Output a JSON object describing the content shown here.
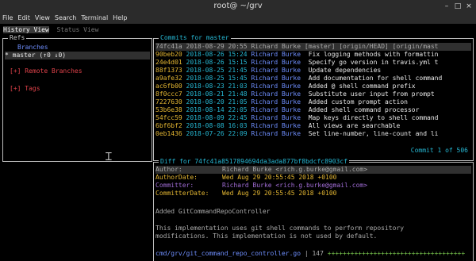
{
  "window": {
    "title": "root@           ~/grv",
    "controls": [
      "–",
      "□",
      "×"
    ]
  },
  "menu": [
    "File",
    "Edit",
    "View",
    "Search",
    "Terminal",
    "Help"
  ],
  "tabs": {
    "active": "History View",
    "inactive": "Status View"
  },
  "refs": {
    "title": "Refs",
    "branches_header": "Branches",
    "branch_marker": "*",
    "current_branch": "master (↑0 ↓0)",
    "remote_branches": "[+] Remote Branches",
    "tags": "[+] Tags"
  },
  "commits": {
    "title": "Commits for master",
    "footer": "Commit 1 of 506",
    "rows": [
      {
        "hash": "74fc41a",
        "date": "2018-08-29 20:55",
        "author": "Richard Burke",
        "refs": "[master] [origin/HEAD] [origin/mast",
        "message": ""
      },
      {
        "hash": "90beb20",
        "date": "2018-08-26 15:24",
        "author": "Richard Burke",
        "refs": "",
        "message": "Fix logging methods with formattin"
      },
      {
        "hash": "24e4d01",
        "date": "2018-08-26 15:15",
        "author": "Richard Burke",
        "refs": "",
        "message": "Specify go version in travis.yml t"
      },
      {
        "hash": "88f1373",
        "date": "2018-08-25 21:45",
        "author": "Richard Burke",
        "refs": "",
        "message": "Update dependencies"
      },
      {
        "hash": "a9afe32",
        "date": "2018-08-25 15:45",
        "author": "Richard Burke",
        "refs": "",
        "message": "Add documentation for shell command"
      },
      {
        "hash": "ac6fb00",
        "date": "2018-08-23 21:03",
        "author": "Richard Burke",
        "refs": "",
        "message": "Added @ shell command prefix"
      },
      {
        "hash": "8f0ccc7",
        "date": "2018-08-21 21:48",
        "author": "Richard Burke",
        "refs": "",
        "message": "Substitute user input from prompt"
      },
      {
        "hash": "7227630",
        "date": "2018-08-20 21:05",
        "author": "Richard Burke",
        "refs": "",
        "message": "Added custom prompt action"
      },
      {
        "hash": "53b6e38",
        "date": "2018-08-14 22:05",
        "author": "Richard Burke",
        "refs": "",
        "message": "Added shell command processor"
      },
      {
        "hash": "54fcc59",
        "date": "2018-08-09 22:45",
        "author": "Richard Burke",
        "refs": "",
        "message": "Map keys directly to shell command"
      },
      {
        "hash": "6bf6bf2",
        "date": "2018-08-08 16:03",
        "author": "Richard Burke",
        "refs": "",
        "message": "All views are searchable"
      },
      {
        "hash": "0eb1436",
        "date": "2018-07-26 22:09",
        "author": "Richard Burke",
        "refs": "",
        "message": "Set line-number, line-count and li"
      }
    ]
  },
  "diff": {
    "title": "Diff for 74fc41a8517894694da3ada877bf8bdcfc8903cf",
    "author_label": "Author:",
    "author_value": "Richard Burke <rich.g.burke@gmail.com>",
    "author_date_label": "AuthorDate:",
    "author_date_value": "Wed Aug 29 20:55:45 2018 +0100",
    "committer_label": "Committer:",
    "committer_value": "Richard Burke <rich.g.burke@gmail.com>",
    "committer_date_label": "CommitterDate:",
    "committer_date_value": "Wed Aug 29 20:55:45 2018 +0100",
    "subject": "Added GitCommandRepoController",
    "body_line_1": "This implementation uses git shell commands to perform repository",
    "body_line_2": "modifications. This implementation is not used by default.",
    "stat_file": "cmd/grv/git_command_repo_controller.go",
    "stat_sep": " | ",
    "stat_count": "147",
    "stat_bar": " ++++++++++++++++++++++++++++++++++++"
  }
}
